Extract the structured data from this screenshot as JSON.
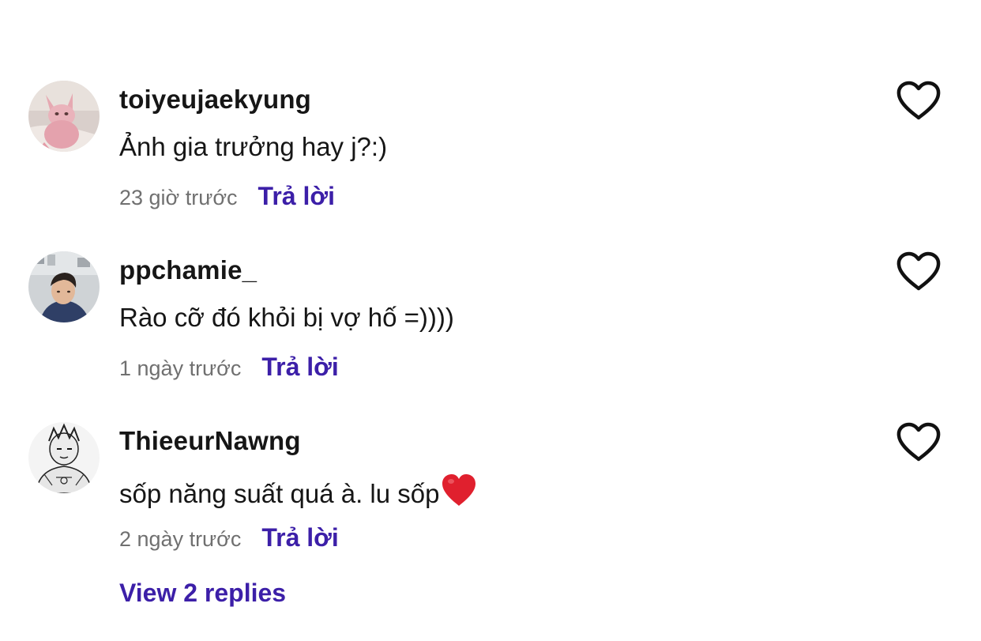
{
  "comments": [
    {
      "username": "toiyeujaekyung",
      "text": "Ảnh gia trưởng hay j?:)",
      "time": "23 giờ trước",
      "reply_label": "Trả lời",
      "avatar_icon": "sphynx-cat-avatar"
    },
    {
      "username": "ppchamie_",
      "text": "Rào cỡ đó khỏi bị vợ hố =))))",
      "time": "1 ngày trước",
      "reply_label": "Trả lời",
      "avatar_icon": "person-photo-avatar"
    },
    {
      "username": "ThieeurNawng",
      "text": "sốp năng suất quá à. lu sốp",
      "text_emoji": "red-heart-emoji",
      "time": "2 ngày trước",
      "reply_label": "Trả lời",
      "avatar_icon": "manga-sketch-avatar"
    }
  ],
  "view_replies_label": "View 2 replies",
  "colors": {
    "link": "#3c1fa8",
    "timestamp": "#707070",
    "text": "#161616",
    "heart_emoji": "#e0202e"
  }
}
